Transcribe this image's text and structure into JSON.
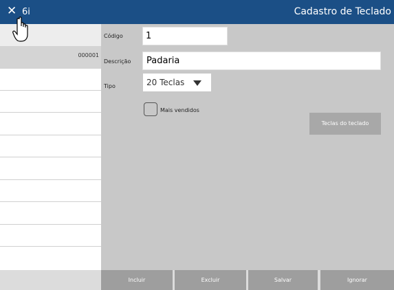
{
  "titlebar": {
    "close_glyph": "✕",
    "app_label": "6i",
    "title": "Cadastro de Teclado"
  },
  "sidebar": {
    "selected_code": "000001"
  },
  "form": {
    "codigo_label": "Código",
    "codigo_value": "1",
    "descricao_label": "Descrição",
    "descricao_value": "Padaria",
    "tipo_label": "Tipo",
    "tipo_value": "20 Teclas",
    "mais_vendidos_label": "Mais vendidos",
    "mais_vendidos_checked": false,
    "teclas_button": "Teclas do teclado"
  },
  "toolbar": {
    "incluir": "Incluir",
    "excluir": "Excluir",
    "salvar": "Salvar",
    "ignorar": "Ignorar"
  },
  "icons": {
    "close": "close-icon",
    "cursor": "hand-cursor-icon",
    "caret": "chevron-down-icon"
  },
  "colors": {
    "titlebar": "#1b4f86",
    "background": "#c8c8c8",
    "button": "#9e9e9e"
  }
}
